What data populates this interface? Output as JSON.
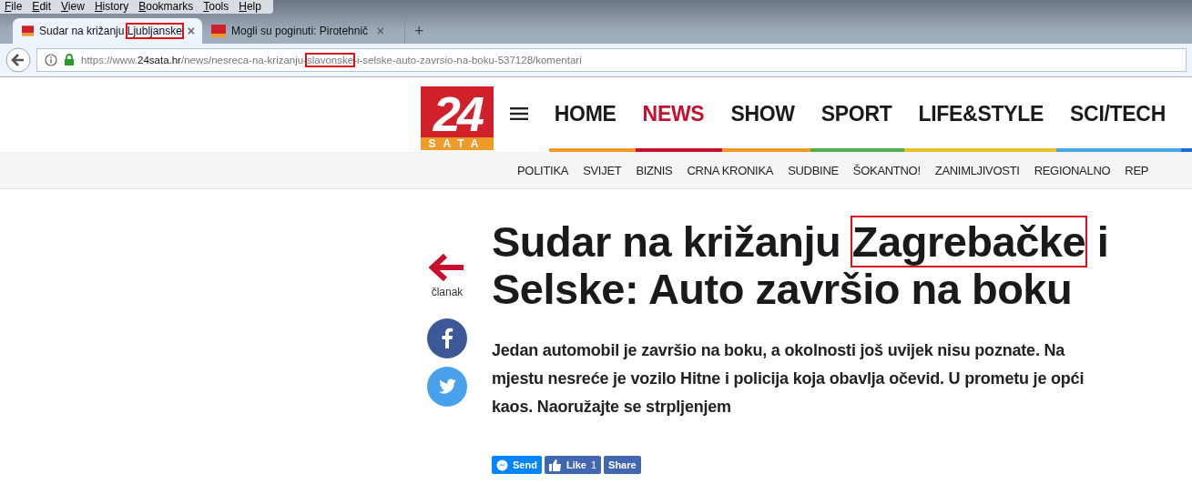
{
  "menu_bar": [
    "File",
    "Edit",
    "View",
    "History",
    "Bookmarks",
    "Tools",
    "Help"
  ],
  "tabs": [
    {
      "title": [
        {
          "text": "Sudar na križanju ",
          "marked": false
        },
        {
          "text": "Ljubljanske",
          "marked": true
        }
      ],
      "close": "×",
      "selected": true
    },
    {
      "title": [
        {
          "text": "Mogli su poginuti: Pirotehnič",
          "marked": false
        }
      ],
      "close": "×",
      "selected": false
    }
  ],
  "new_tab": "+",
  "address_bar": {
    "url": [
      {
        "text": "https://www.",
        "kind": "dim",
        "marked": false
      },
      {
        "text": "24sata.hr",
        "kind": "host",
        "marked": false
      },
      {
        "text": "/news/nesreca-na-krizanju-",
        "kind": "dim",
        "marked": false
      },
      {
        "text": "slavonske",
        "kind": "dim",
        "marked": true
      },
      {
        "text": "-i-selske-auto-zavrsio-na-boku-537128/komentari",
        "kind": "dim",
        "marked": false
      }
    ]
  },
  "logo": {
    "number": "24",
    "word": "SATA"
  },
  "nav": [
    {
      "label": "HOME",
      "selected": false,
      "color": "#f09a2a"
    },
    {
      "label": "NEWS",
      "selected": true,
      "color": "#c8102e"
    },
    {
      "label": "SHOW",
      "selected": false,
      "color": "#f09a2a"
    },
    {
      "label": "SPORT",
      "selected": false,
      "color": "#4caf50"
    },
    {
      "label": "LIFE&STYLE",
      "selected": false,
      "color": "#e8c02a"
    },
    {
      "label": "SCI/TECH",
      "selected": false,
      "color": "#4aa8e8"
    }
  ],
  "subnav": [
    "POLITIKA",
    "SVIJET",
    "BIZNIS",
    "CRNA KRONIKA",
    "SUDBINE",
    "ŠOKANTNO!",
    "ZANIMLJIVOSTI",
    "REGIONALNO",
    "REP"
  ],
  "back_link": "članak",
  "headline": [
    [
      {
        "text": "Sudar na križanju ",
        "marked": false
      },
      {
        "text": "Zagrebačke",
        "marked": true
      },
      {
        "text": " i",
        "marked": false
      }
    ],
    [
      {
        "text": "Selske: Auto završio na boku",
        "marked": false
      }
    ]
  ],
  "lead": [
    "Jedan automobil je završio na boku, a okolnosti još uvijek nisu poznate. Na",
    "mjestu nesreće je vozilo Hitne i policija koja obavlja očevid. U prometu je opći",
    "kaos. Naoružajte se strpljenjem"
  ],
  "social_buttons": [
    {
      "kind": "send",
      "label": "Send"
    },
    {
      "kind": "like",
      "label": "Like",
      "count": "1"
    },
    {
      "kind": "share",
      "label": "Share"
    }
  ]
}
